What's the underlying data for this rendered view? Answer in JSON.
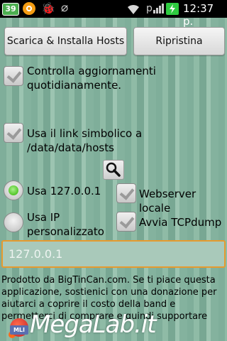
{
  "status_bar": {
    "badge": "39",
    "time": "12:37 p.",
    "icons": [
      "orange-app-icon",
      "bug-icon",
      "usb-icon",
      "wifi-icon",
      "signal-icon",
      "battery-icon"
    ]
  },
  "buttons": {
    "install": "Scarica & Installa Hosts",
    "restore": "Ripristina"
  },
  "options": {
    "daily_check": "Controlla aggiornamenti quotidianamente.",
    "symlink": "Usa il link simbolico a /data/data/hosts",
    "use_localhost": "Usa 127.0.0.1",
    "use_custom_ip": "Usa IP personalizzato",
    "webserver": "Webserver locale",
    "tcpdump": "Avvia TCPdump"
  },
  "ip_input": {
    "value": "127.0.0.1"
  },
  "description": "Prodotto da BigTinCan.com. Se ti piace questa applicazione, sostienici con una donazione per aiutarci a coprire il costo della band e permetterci di comprare e quindi supportare",
  "watermark": {
    "badge": "MLI",
    "text": "MegaLab.it"
  }
}
